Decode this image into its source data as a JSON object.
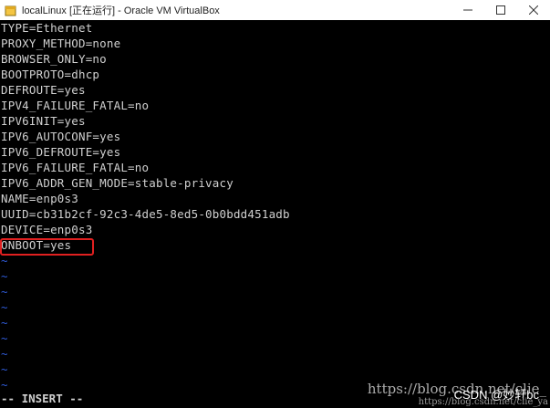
{
  "window": {
    "title": "localLinux [正在运行] - Oracle VM VirtualBox",
    "controls": {
      "minimize": "—",
      "maximize": "☐",
      "close": "✕"
    }
  },
  "editor": {
    "lines": [
      "TYPE=Ethernet",
      "PROXY_METHOD=none",
      "BROWSER_ONLY=no",
      "BOOTPROTO=dhcp",
      "DEFROUTE=yes",
      "IPV4_FAILURE_FATAL=no",
      "IPV6INIT=yes",
      "IPV6_AUTOCONF=yes",
      "IPV6_DEFROUTE=yes",
      "IPV6_FAILURE_FATAL=no",
      "IPV6_ADDR_GEN_MODE=stable-privacy",
      "NAME=enp0s3",
      "UUID=cb31b2cf-92c3-4de5-8ed5-0b0bdd451adb",
      "DEVICE=enp0s3",
      "ONBOOT=yes"
    ],
    "empty_line_marker": "~",
    "mode": "-- INSERT --"
  },
  "watermark": {
    "url": "https://blog.csdn.net/clie_",
    "url_small": "https://blog.csdn.net/clie_ya",
    "csdn": "CSDN @妙轩bc"
  },
  "colors": {
    "tilde": "#2f5bd8",
    "highlight_border": "#e02020"
  }
}
